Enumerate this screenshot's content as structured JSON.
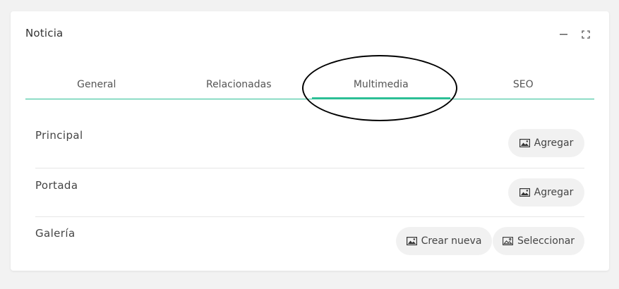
{
  "card": {
    "title": "Noticia",
    "tools": {
      "minimize_icon": "minus-icon",
      "fullscreen_icon": "expand-icon"
    }
  },
  "tabs": [
    {
      "label": "General",
      "active": false
    },
    {
      "label": "Relacionadas",
      "active": false
    },
    {
      "label": "Multimedia",
      "active": true
    },
    {
      "label": "SEO",
      "active": false
    }
  ],
  "sections": {
    "principal": {
      "label": "Principal",
      "add_label": "Agregar",
      "icon": "image-icon"
    },
    "portada": {
      "label": "Portada",
      "add_label": "Agregar",
      "icon": "image-icon"
    },
    "galeria": {
      "label": "Galería",
      "create_label": "Crear nueva",
      "select_label": "Seleccionar",
      "create_icon": "image-icon",
      "select_icon": "image-outline-icon"
    }
  },
  "colors": {
    "accent": "#2bbf95",
    "annotation": "#000000",
    "pill_bg": "#f1f1f1"
  }
}
